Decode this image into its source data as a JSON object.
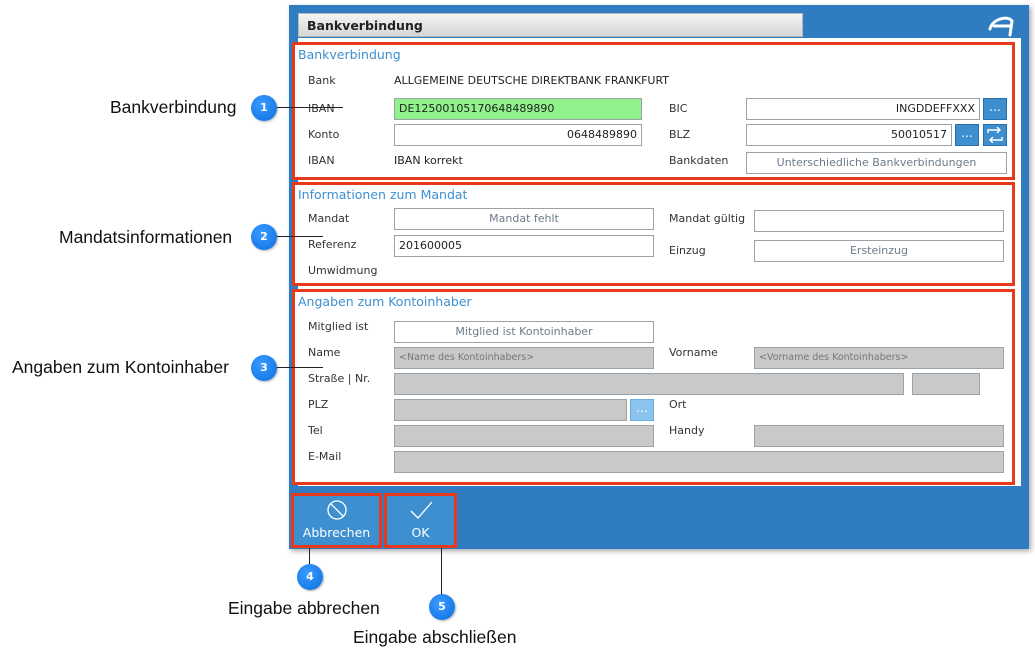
{
  "window": {
    "title": "Bankverbindung",
    "accent": "#2f7cc0",
    "highlight": "#e8391a"
  },
  "sec1": {
    "title": "Bankverbindung",
    "bank_label": "Bank",
    "bank_value": "ALLGEMEINE DEUTSCHE DIREKTBANK FRANKFURT",
    "iban_label": "IBAN",
    "iban_value": "DE12500105170648489890",
    "bic_label": "BIC",
    "bic_value": "INGDDEFFXXX",
    "konto_label": "Konto",
    "konto_value": "0648489890",
    "blz_label": "BLZ",
    "blz_value": "50010517",
    "iban_status_label": "IBAN",
    "iban_status_value": "IBAN korrekt",
    "bankdaten_label": "Bankdaten",
    "bankdaten_value": "Unterschiedliche Bankverbindungen",
    "more_label": "..."
  },
  "sec2": {
    "title": "Informationen zum Mandat",
    "mandat_label": "Mandat",
    "mandat_value": "Mandat fehlt",
    "mandat_gueltig_label": "Mandat gültig",
    "mandat_gueltig_value": "",
    "referenz_label": "Referenz",
    "referenz_value": "201600005",
    "einzug_label": "Einzug",
    "einzug_value": "Ersteinzug",
    "umwidmung_label": "Umwidmung"
  },
  "sec3": {
    "title": "Angaben zum Kontoinhaber",
    "mitglied_label": "Mitglied ist",
    "mitglied_value": "Mitglied ist Kontoinhaber",
    "name_label": "Name",
    "name_placeholder": "<Name des Kontoinhabers>",
    "vorname_label": "Vorname",
    "vorname_placeholder": "<Vorname des Kontoinhabers>",
    "strasse_label": "Straße | Nr.",
    "plz_label": "PLZ",
    "ort_label": "Ort",
    "tel_label": "Tel",
    "handy_label": "Handy",
    "email_label": "E-Mail",
    "more_label": "..."
  },
  "buttons": {
    "cancel_label": "Abbrechen",
    "ok_label": "OK"
  },
  "callouts": [
    {
      "number": "1",
      "text": "Bankverbindung"
    },
    {
      "number": "2",
      "text": "Mandatsinformationen"
    },
    {
      "number": "3",
      "text": "Angaben zum Kontoinhaber"
    },
    {
      "number": "4",
      "text": "Eingabe abbrechen"
    },
    {
      "number": "5",
      "text": "Eingabe abschließen"
    }
  ]
}
